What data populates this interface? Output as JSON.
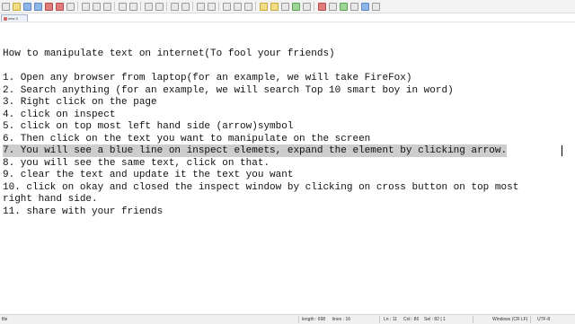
{
  "tab": {
    "label": "new 3"
  },
  "editor": {
    "lines": [
      "",
      "How to manipulate text on internet(To fool your friends)",
      "",
      "1. Open any browser from laptop(for an example, we will take FireFox)",
      "2. Search anything (for an example, we will search Top 10 smart boy in word)",
      "3. Right click on the page",
      "4. click on inspect",
      "5. click on top most left hand side (arrow)symbol",
      "6. Then click on the text you want to manipulate on the screen",
      "7. You will see a blue line on inspect elemets, expand the element by clicking arrow.",
      "8. you will see the same text, click on that.",
      "9. clear the text and update it the text you want",
      "10. click on okay and closed the inspect window by clicking on cross button on top most",
      "right hand side.",
      "11. share with your friends"
    ]
  },
  "status": {
    "filetype": "file",
    "length": "length : 698",
    "lines": "lines : 16",
    "ln": "Ln : 11",
    "col": "Col : 86",
    "sel": "Sel : 82 | 1",
    "eol": "Windows (CR LF)",
    "encoding": "UTF-8"
  }
}
